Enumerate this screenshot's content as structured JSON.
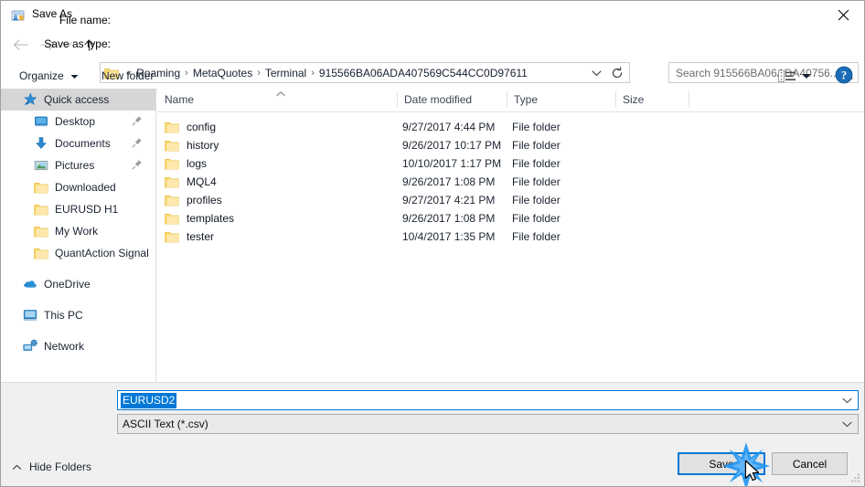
{
  "window": {
    "title": "Save As",
    "title_icon": "save-as-app-icon",
    "close_icon": "close-icon"
  },
  "nav": {
    "back_icon": "back-arrow-icon",
    "forward_icon": "forward-arrow-icon",
    "recent_icon": "chevron-down-icon",
    "up_icon": "up-arrow-icon",
    "address": {
      "folder_icon": "folder-icon",
      "leading_separator": "«",
      "crumbs": [
        "Roaming",
        "MetaQuotes",
        "Terminal",
        "915566BA06ADA407569C544CC0D97611"
      ],
      "separator": "›",
      "dropdown_icon": "chevron-down-icon",
      "refresh_icon": "refresh-icon"
    },
    "search": {
      "placeholder": "Search 915566BA06ADA40756...",
      "icon": "search-icon"
    }
  },
  "commandbar": {
    "organize_label": "Organize",
    "organize_caret_icon": "caret-down-icon",
    "new_folder_label": "New folder",
    "view_mode_icon": "view-details-icon",
    "view_mode_caret_icon": "caret-down-icon",
    "help_icon": "help-icon"
  },
  "sidebar": {
    "items": [
      {
        "label": "Quick access",
        "icon": "quick-access-star-icon",
        "level": 0,
        "selected": true,
        "pinned": false
      },
      {
        "label": "Desktop",
        "icon": "desktop-icon",
        "level": 1,
        "selected": false,
        "pinned": true
      },
      {
        "label": "Documents",
        "icon": "documents-download-icon",
        "level": 1,
        "selected": false,
        "pinned": true
      },
      {
        "label": "Pictures",
        "icon": "pictures-icon",
        "level": 1,
        "selected": false,
        "pinned": true
      },
      {
        "label": "Downloaded",
        "icon": "folder-icon",
        "level": 1,
        "selected": false,
        "pinned": false
      },
      {
        "label": "EURUSD H1",
        "icon": "folder-icon",
        "level": 1,
        "selected": false,
        "pinned": false
      },
      {
        "label": "My Work",
        "icon": "folder-icon",
        "level": 1,
        "selected": false,
        "pinned": false
      },
      {
        "label": "QuantAction Signal",
        "icon": "folder-icon",
        "level": 1,
        "selected": false,
        "pinned": false
      },
      {
        "label": "OneDrive",
        "icon": "onedrive-cloud-icon",
        "level": 0,
        "selected": false,
        "pinned": false,
        "gap_before": true
      },
      {
        "label": "This PC",
        "icon": "this-pc-monitor-icon",
        "level": 0,
        "selected": false,
        "pinned": false,
        "gap_before": true
      },
      {
        "label": "Network",
        "icon": "network-icon",
        "level": 0,
        "selected": false,
        "pinned": false,
        "gap_before": true
      }
    ]
  },
  "filelist": {
    "columns": [
      "Name",
      "Date modified",
      "Type",
      "Size"
    ],
    "sort_column": "Name",
    "sort_direction": "ascending",
    "sort_icon": "sort-ascending-icon",
    "rows": [
      {
        "name": "config",
        "date": "9/27/2017 4:44 PM",
        "type": "File folder",
        "size": "",
        "icon": "folder-icon"
      },
      {
        "name": "history",
        "date": "9/26/2017 10:17 PM",
        "type": "File folder",
        "size": "",
        "icon": "folder-icon"
      },
      {
        "name": "logs",
        "date": "10/10/2017 1:17 PM",
        "type": "File folder",
        "size": "",
        "icon": "folder-icon"
      },
      {
        "name": "MQL4",
        "date": "9/26/2017 1:08 PM",
        "type": "File folder",
        "size": "",
        "icon": "folder-icon"
      },
      {
        "name": "profiles",
        "date": "9/27/2017 4:21 PM",
        "type": "File folder",
        "size": "",
        "icon": "folder-icon"
      },
      {
        "name": "templates",
        "date": "9/26/2017 1:08 PM",
        "type": "File folder",
        "size": "",
        "icon": "folder-icon"
      },
      {
        "name": "tester",
        "date": "10/4/2017 1:35 PM",
        "type": "File folder",
        "size": "",
        "icon": "folder-icon"
      }
    ]
  },
  "form": {
    "filename_label": "File name:",
    "filename_value": "EURUSD2",
    "filename_selected": true,
    "filename_caret_icon": "chevron-down-icon",
    "savetype_label": "Save as type:",
    "savetype_value": "ASCII Text (*.csv)",
    "savetype_caret_icon": "chevron-down-icon"
  },
  "footer": {
    "hide_folders_label": "Hide Folders",
    "hide_folders_caret_icon": "caret-up-icon",
    "save_label": "Save",
    "cancel_label": "Cancel",
    "save_focused": true,
    "click_indicator_icon": "click-burst-icon",
    "cursor_icon": "mouse-pointer-icon",
    "resize_grip_icon": "resize-grip-icon"
  },
  "colors": {
    "accent": "#0078d7",
    "selection_bg": "#0078d7",
    "sidebar_selected_bg": "#d6d6d6",
    "folder_yellow": "#ffd769",
    "dialog_bg": "#f0f0f0",
    "help_blue": "#1a6cb5"
  }
}
